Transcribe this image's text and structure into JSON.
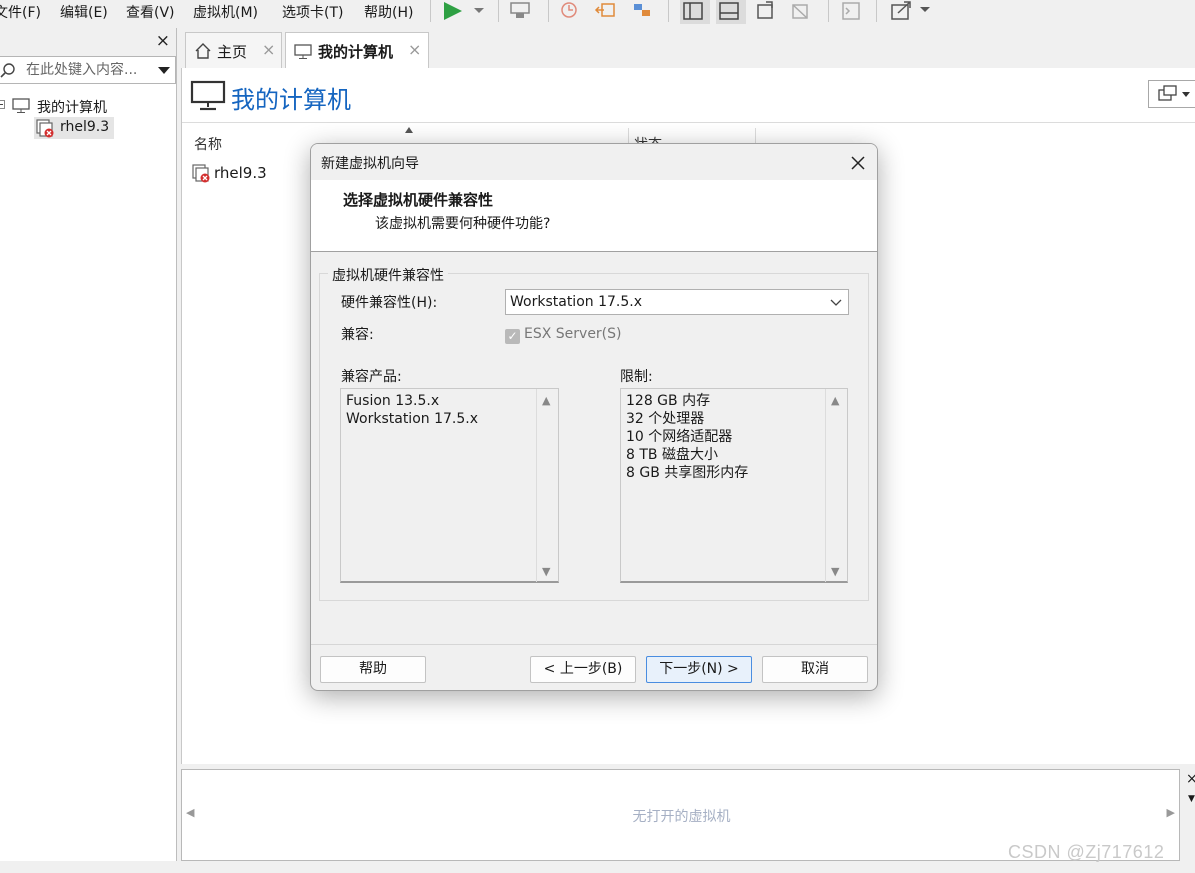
{
  "menu": {
    "items": [
      "文件(F)",
      "编辑(E)",
      "查看(V)",
      "虚拟机(M)",
      "选项卡(T)",
      "帮助(H)"
    ]
  },
  "sidebar": {
    "close": "×",
    "search_placeholder": "在此处键入内容...",
    "tree": {
      "root": "我的计算机",
      "vm": "rhel9.3"
    }
  },
  "tabs": [
    {
      "label": "主页"
    },
    {
      "label": "我的计算机"
    }
  ],
  "main": {
    "title": "我的计算机",
    "col_name": "名称",
    "col_status": "状态",
    "rows": [
      {
        "name": "rhel9.3"
      }
    ]
  },
  "thumbnail_bar": {
    "empty_text": "无打开的虚拟机"
  },
  "dialog": {
    "title": "新建虚拟机向导",
    "heading": "选择虚拟机硬件兼容性",
    "subheading": "该虚拟机需要何种硬件功能?",
    "group_title": "虚拟机硬件兼容性",
    "hw_label": "硬件兼容性(H):",
    "hw_value": "Workstation 17.5.x",
    "compat_label": "兼容:",
    "esx_label": "ESX Server(S)",
    "esx_checked": true,
    "products_label": "兼容产品:",
    "products": [
      "Fusion 13.5.x",
      "Workstation 17.5.x"
    ],
    "limits_label": "限制:",
    "limits": [
      "128 GB 内存",
      "32 个处理器",
      "10 个网络适配器",
      "8 TB 磁盘大小",
      "8 GB 共享图形内存"
    ],
    "buttons": {
      "help": "帮助",
      "back": "< 上一步(B)",
      "next": "下一步(N) >",
      "cancel": "取消"
    }
  },
  "watermark": "CSDN @Zj717612",
  "colors": {
    "accent_blue": "#1565c0",
    "play_green": "#2ea043",
    "vm_error_red": "#d32f2f"
  }
}
